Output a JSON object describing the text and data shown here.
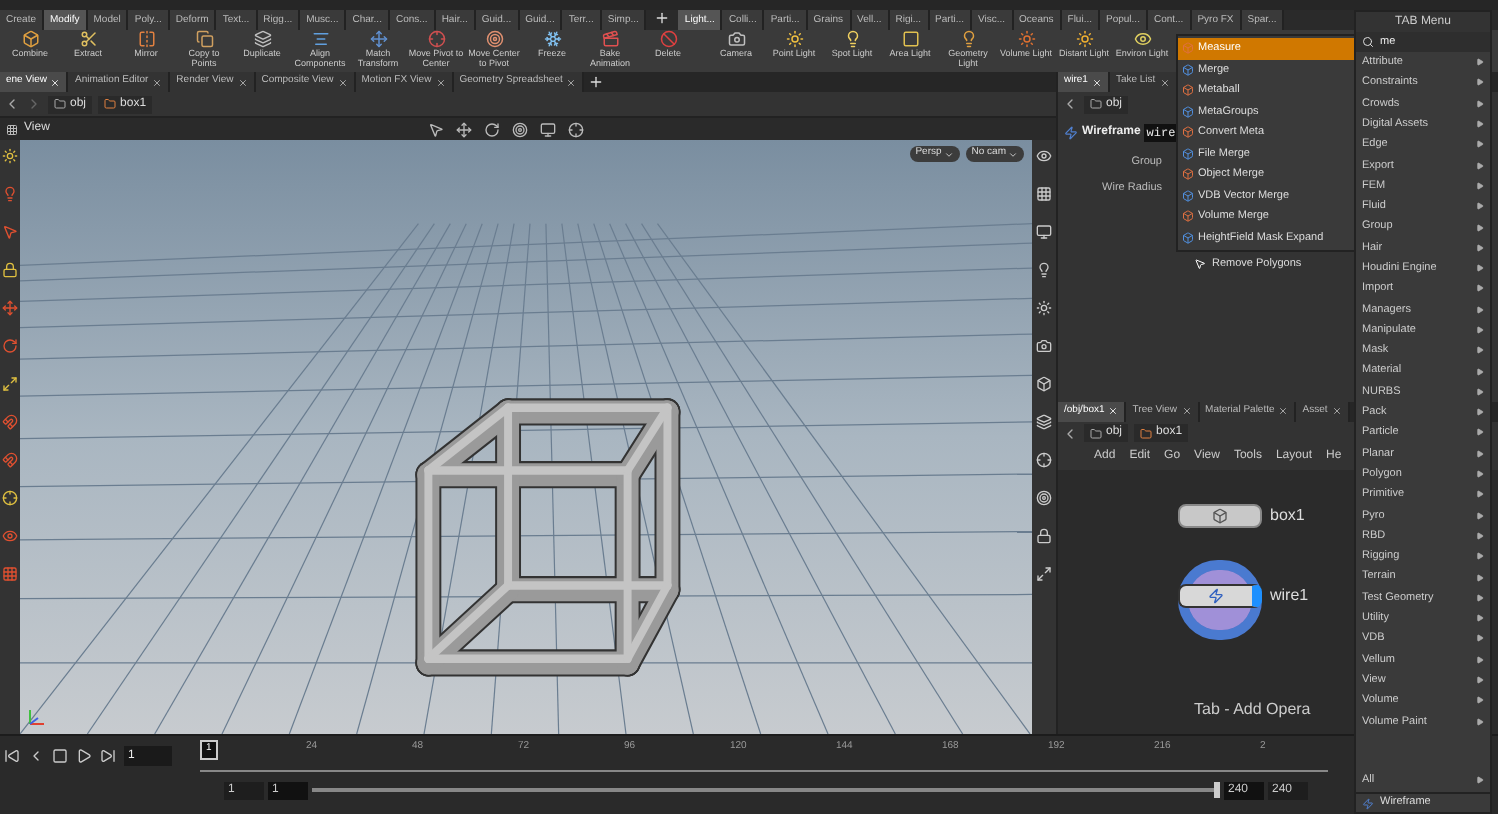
{
  "shelf_tabs_left": [
    {
      "label": "Create",
      "selected": false
    },
    {
      "label": "Modify",
      "selected": true
    },
    {
      "label": "Model",
      "selected": false
    },
    {
      "label": "Poly...",
      "selected": false
    },
    {
      "label": "Deform",
      "selected": false
    },
    {
      "label": "Text...",
      "selected": false
    },
    {
      "label": "Rigg...",
      "selected": false
    },
    {
      "label": "Musc...",
      "selected": false
    },
    {
      "label": "Char...",
      "selected": false
    },
    {
      "label": "Cons...",
      "selected": false
    },
    {
      "label": "Hair...",
      "selected": false
    },
    {
      "label": "Guid...",
      "selected": false
    },
    {
      "label": "Guid...",
      "selected": false
    },
    {
      "label": "Terr...",
      "selected": false
    },
    {
      "label": "Simp...",
      "selected": false
    }
  ],
  "shelf_tabs_right": [
    {
      "label": "Light...",
      "selected": true
    },
    {
      "label": "Colli...",
      "selected": false
    },
    {
      "label": "Parti...",
      "selected": false
    },
    {
      "label": "Grains",
      "selected": false
    },
    {
      "label": "Vell...",
      "selected": false
    },
    {
      "label": "Rigi...",
      "selected": false
    },
    {
      "label": "Parti...",
      "selected": false
    },
    {
      "label": "Visc...",
      "selected": false
    },
    {
      "label": "Oceans",
      "selected": false
    },
    {
      "label": "Flui...",
      "selected": false
    },
    {
      "label": "Popul...",
      "selected": false
    },
    {
      "label": "Cont...",
      "selected": false
    },
    {
      "label": "Pyro FX",
      "selected": false
    },
    {
      "label": "Spar...",
      "selected": false
    }
  ],
  "shelf_tools_left": [
    "Combine",
    "Extract",
    "Mirror",
    "Copy to Points",
    "Duplicate",
    "Align Components",
    "Match Transform",
    "Move Pivot to Center",
    "Move Center to Pivot",
    "Freeze",
    "Bake Animation",
    "Delete"
  ],
  "shelf_tools_right": [
    "Camera",
    "Point Light",
    "Spot Light",
    "Area Light",
    "Geometry Light",
    "Volume Light",
    "Distant Light",
    "Environ Light"
  ],
  "pane_tabs": [
    {
      "label": "ene View",
      "selected": true
    },
    {
      "label": "Animation Editor",
      "selected": false
    },
    {
      "label": "Render View",
      "selected": false
    },
    {
      "label": "Composite View",
      "selected": false
    },
    {
      "label": "Motion FX View",
      "selected": false
    },
    {
      "label": "Geometry Spreadsheet",
      "selected": false
    }
  ],
  "scene_path": [
    "obj",
    "box1"
  ],
  "viewport": {
    "title": "View",
    "camera_buttons": [
      "Persp",
      "No cam"
    ]
  },
  "params_pane": {
    "tabs": [
      {
        "label": "wire1",
        "selected": true
      },
      {
        "label": "Take List",
        "selected": false
      }
    ],
    "path": "obj",
    "node_type": "Wireframe",
    "node_name": "wire",
    "labels": [
      "Group",
      "Wire Radius"
    ]
  },
  "network_pane": {
    "tabs": [
      {
        "label": "/obj/box1",
        "selected": true
      },
      {
        "label": "Tree View",
        "selected": false
      },
      {
        "label": "Material Palette",
        "selected": false
      },
      {
        "label": "Asset",
        "selected": false
      }
    ],
    "path": [
      "obj",
      "box1"
    ],
    "menu": [
      "Add",
      "Edit",
      "Go",
      "View",
      "Tools",
      "Layout",
      "He"
    ],
    "nodes": [
      {
        "name": "box1",
        "selected": false
      },
      {
        "name": "wire1",
        "selected": true
      }
    ],
    "hint": "Tab - Add Opera"
  },
  "timeline": {
    "frame": "1",
    "marker": "1",
    "ticks": [
      "24",
      "48",
      "72",
      "96",
      "120",
      "144",
      "168",
      "192",
      "216",
      "2"
    ],
    "range_start": "1",
    "range_start_2": "1",
    "range_end": "240",
    "range_end_2": "240",
    "range_bar": {
      "level": 1
    }
  },
  "search_results": [
    {
      "label": "Measure",
      "selected": true
    },
    {
      "label": "Merge",
      "selected": false
    },
    {
      "label": "Metaball",
      "selected": false
    },
    {
      "label": "MetaGroups",
      "selected": false
    },
    {
      "label": "Convert Meta",
      "selected": false
    },
    {
      "label": "File Merge",
      "selected": false
    },
    {
      "label": "Object Merge",
      "selected": false
    },
    {
      "label": "VDB Vector Merge",
      "selected": false
    },
    {
      "label": "Volume Merge",
      "selected": false
    },
    {
      "label": "HeightField Mask Expand",
      "selected": false
    }
  ],
  "hover_item": "Remove Polygons",
  "tab_menu": {
    "title": "TAB Menu",
    "search": "me",
    "categories": [
      "Attribute",
      "Constraints",
      "Crowds",
      "Digital Assets",
      "Edge",
      "Export",
      "FEM",
      "Fluid",
      "Group",
      "Hair",
      "Houdini Engine",
      "Import",
      "Managers",
      "Manipulate",
      "Mask",
      "Material",
      "NURBS",
      "Pack",
      "Particle",
      "Planar",
      "Polygon",
      "Primitive",
      "Pyro",
      "RBD",
      "Rigging",
      "Terrain",
      "Test Geometry",
      "Utility",
      "VDB",
      "Vellum",
      "View",
      "Volume",
      "Volume Paint"
    ],
    "all": "All",
    "recent": "Wireframe"
  }
}
